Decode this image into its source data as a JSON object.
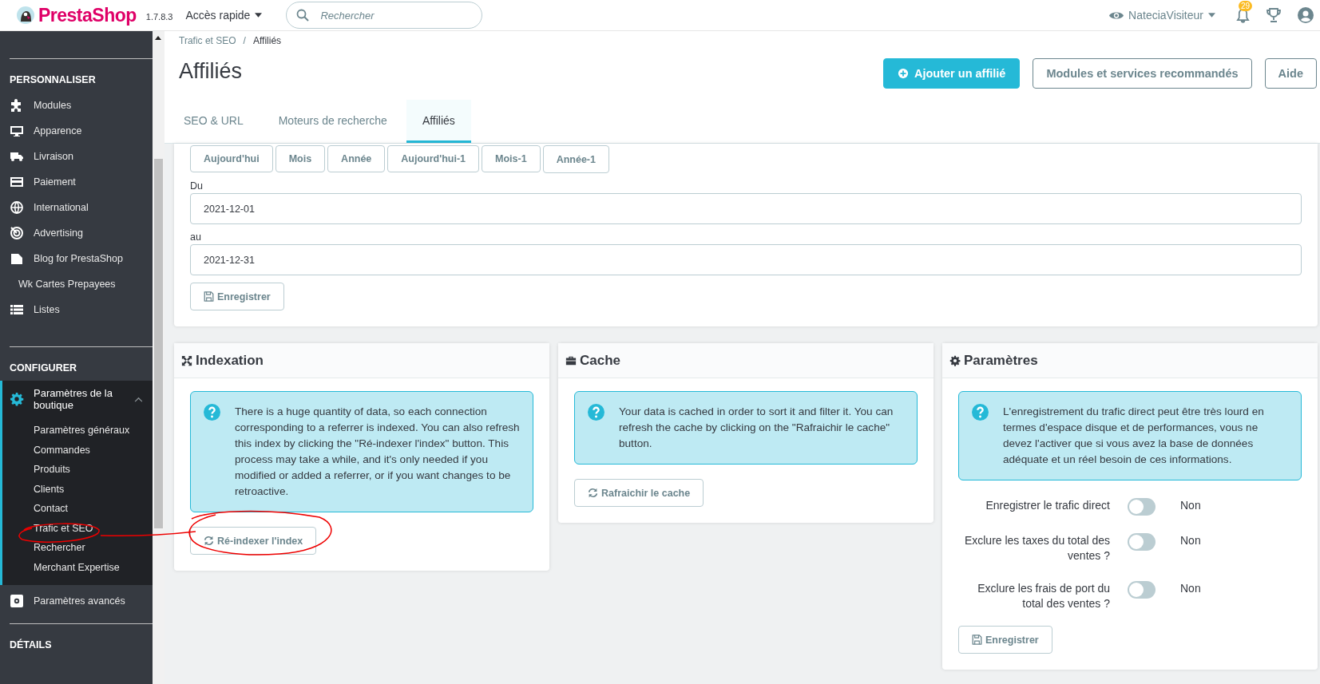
{
  "topbar": {
    "logo_text": "PrestaShop",
    "version": "1.7.8.3",
    "quick_access": "Accès rapide",
    "search": {
      "placeholder": "Rechercher"
    },
    "user": "NateciaVisiteur",
    "notifications": "29"
  },
  "sidebar": {
    "sections": [
      {
        "heading": "PERSONNALISER",
        "items": [
          {
            "label": "Modules",
            "expanded": false
          },
          {
            "label": "Apparence",
            "expanded": false
          },
          {
            "label": "Livraison",
            "expanded": false
          },
          {
            "label": "Paiement",
            "expanded": false
          },
          {
            "label": "International",
            "expanded": false
          },
          {
            "label": "Advertising",
            "expanded": false
          },
          {
            "label": "Blog for PrestaShop",
            "expanded": false
          },
          {
            "label": "Wk Cartes Prepayees",
            "expanded": false
          },
          {
            "label": "Listes",
            "expanded": false
          }
        ]
      },
      {
        "heading": "CONFIGURER",
        "items": [
          {
            "label": "Paramètres de la boutique",
            "expanded": true,
            "children": [
              {
                "label": "Paramètres généraux"
              },
              {
                "label": "Commandes"
              },
              {
                "label": "Produits"
              },
              {
                "label": "Clients"
              },
              {
                "label": "Contact"
              },
              {
                "label": "Trafic et SEO"
              },
              {
                "label": "Rechercher"
              },
              {
                "label": "Merchant Expertise"
              }
            ]
          },
          {
            "label": "Paramètres avancés",
            "expanded": false
          }
        ]
      },
      {
        "heading": "DÉTAILS"
      }
    ]
  },
  "breadcrumb": [
    "Trafic et SEO",
    "Affiliés"
  ],
  "breadcrumb_separator": "/",
  "title": "Affiliés",
  "header_buttons": [
    {
      "label": "Ajouter un affilié",
      "kind": "primary"
    },
    {
      "label": "Modules et services recommandés",
      "kind": "default"
    },
    {
      "label": "Aide",
      "kind": "default"
    }
  ],
  "tabs": [
    {
      "label": "SEO & URL",
      "selected": false
    },
    {
      "label": "Moteurs de recherche",
      "selected": false
    },
    {
      "label": "Affiliés",
      "selected": true
    }
  ],
  "date_panel": {
    "quick_buttons": [
      "Aujourd'hui",
      "Mois",
      "Année",
      "Aujourd'hui-1",
      "Mois-1",
      "Année-1"
    ],
    "fields": [
      {
        "label": "Du",
        "value": "2021-12-01"
      },
      {
        "label": "au",
        "value": "2021-12-31"
      }
    ],
    "save_button": "Enregistrer"
  },
  "panels": [
    {
      "title": "Indexation",
      "info": "There is a huge quantity of data, so each connection corresponding to a referrer is indexed. You can also refresh this index by clicking the \"Ré-indexer l'index\" button. This process may take a while, and it's only needed if you modified or added a referrer, or if you want changes to be retroactive.",
      "button": {
        "label": "Ré-indexer l'index",
        "kind": "refresh"
      }
    },
    {
      "title": "Cache",
      "info": "Your data is cached in order to sort it and filter it. You can refresh the cache by clicking on the \"Rafraichir le cache\" button.",
      "button": {
        "label": "Rafraichir le cache",
        "kind": "refresh"
      }
    },
    {
      "title": "Paramètres",
      "info": "L'enregistrement du trafic direct peut être très lourd en termes d'espace disque et de performances, vous ne devez l'activer que si vous avez la base de données adéquate et un réel besoin de ces informations.",
      "switches": [
        {
          "label": "Enregistrer le trafic direct",
          "on": false,
          "value_text": "Non"
        },
        {
          "label": "Exclure les taxes du total des ventes ?",
          "on": false,
          "value_text": "Non"
        },
        {
          "label": "Exclure les frais de port du total des ventes ?",
          "on": false,
          "value_text": "Non"
        }
      ],
      "button": {
        "label": "Enregistrer",
        "kind": "save"
      }
    }
  ]
}
